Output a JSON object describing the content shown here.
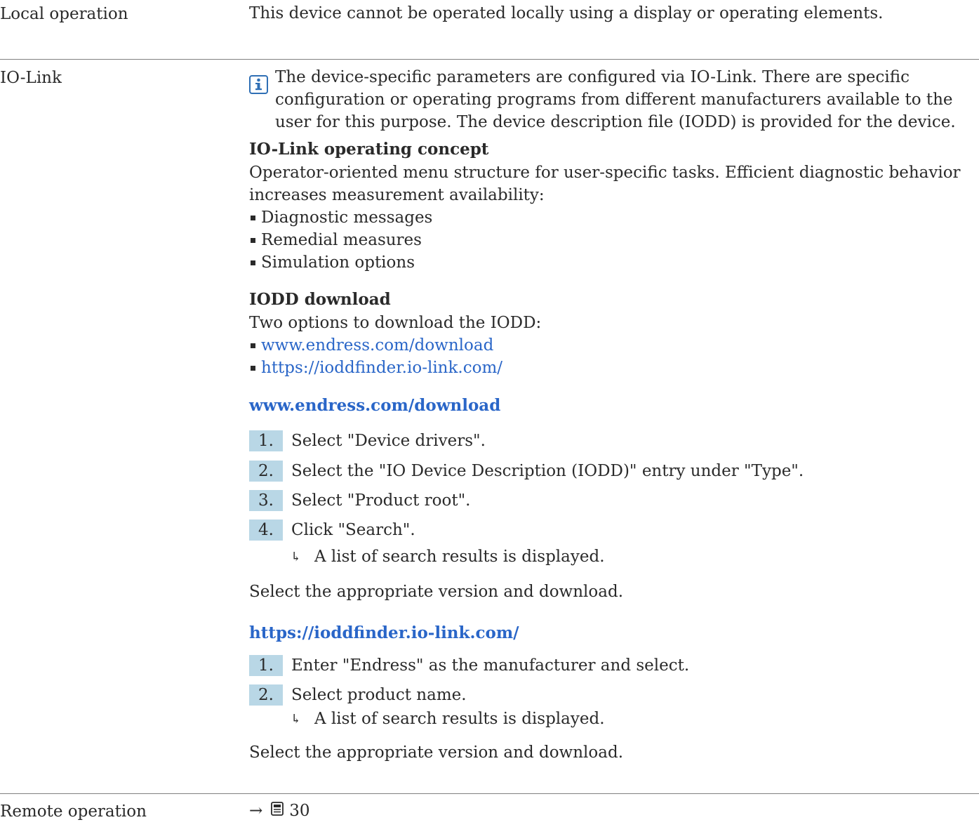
{
  "local": {
    "label": "Local operation",
    "text": "This device cannot be operated locally using a display or operating elements."
  },
  "iolink": {
    "label": "IO-Link",
    "note_lines": [
      "The device-specific parameters are configured via IO-Link. There are specific",
      "configuration or operating programs from different manufacturers available to the",
      "user for this purpose. The device description file (IODD) is provided for the device."
    ],
    "concept": {
      "heading": "IO-Link operating concept",
      "desc_lines": [
        "Operator-oriented menu structure for user-specific tasks. Efficient diagnostic behavior",
        "increases measurement availability:"
      ],
      "bullets": [
        "Diagnostic messages",
        "Remedial measures",
        "Simulation options"
      ]
    },
    "download": {
      "heading": "IODD download",
      "intro": "Two options to download the IODD:",
      "links": [
        "www.endress.com/download",
        "https://ioddfinder.io-link.com/"
      ]
    },
    "endress": {
      "heading": "www.endress.com/download",
      "steps": [
        {
          "num": "1.",
          "text": "Select \"Device drivers\"."
        },
        {
          "num": "2.",
          "text": "Select the \"IO Device Description (IODD)\" entry under \"Type\"."
        },
        {
          "num": "3.",
          "text": "Select \"Product root\"."
        },
        {
          "num": "4.",
          "text": "Click \"Search\"."
        }
      ],
      "result": "A list of search results is displayed.",
      "conclusion": "Select the appropriate version and download."
    },
    "finder": {
      "heading": "https://ioddfinder.io-link.com/",
      "steps": [
        {
          "num": "1.",
          "text": "Enter \"Endress\" as the manufacturer and select."
        },
        {
          "num": "2.",
          "text": "Select product name."
        }
      ],
      "result": "A list of search results is displayed.",
      "conclusion": "Select the appropriate version and download."
    }
  },
  "remote": {
    "label": "Remote operation",
    "ref_arrow": "→",
    "ref_page": "30"
  },
  "colors": {
    "link": "#2a66c8",
    "step_bg": "#b9d7e6",
    "info_icon": "#2f6fb5"
  }
}
